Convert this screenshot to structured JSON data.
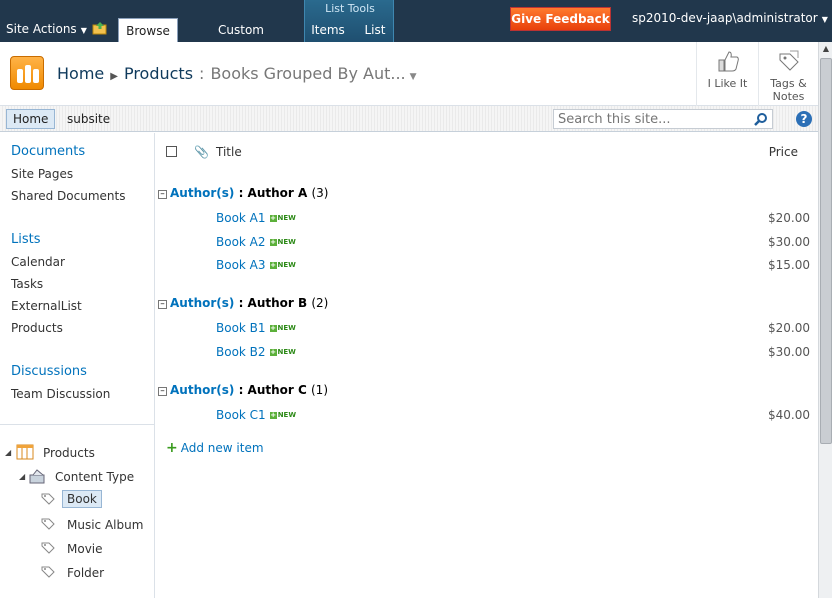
{
  "ribbon": {
    "site_actions": "Site Actions",
    "tabs": {
      "browse": "Browse",
      "custom": "Custom Commands",
      "items": "Items",
      "list": "List"
    },
    "contextual_group": "List Tools",
    "feedback": "Give Feedback",
    "user": "sp2010-dev-jaap\\administrator"
  },
  "title": {
    "home": "Home",
    "list": "Products",
    "view": "Books Grouped By Aut...",
    "like": "I Like It",
    "tags": "Tags &",
    "notes": "Notes"
  },
  "topnav": {
    "home": "Home",
    "subsite": "subsite",
    "search_placeholder": "Search this site...",
    "help": "?"
  },
  "leftnav": {
    "documents": "Documents",
    "site_pages": "Site Pages",
    "shared_documents": "Shared Documents",
    "lists": "Lists",
    "calendar": "Calendar",
    "tasks": "Tasks",
    "externallist": "ExternalList",
    "products": "Products",
    "discussions": "Discussions",
    "team_discussion": "Team Discussion",
    "tree": {
      "products": "Products",
      "content_type": "Content Type",
      "book": "Book",
      "music_album": "Music Album",
      "movie": "Movie",
      "folder": "Folder"
    }
  },
  "list": {
    "headers": {
      "title": "Title",
      "price": "Price"
    },
    "group_field": "Author(s)",
    "groups": [
      {
        "name": "Author A",
        "count": "(3)",
        "items": [
          {
            "title": "Book A1",
            "price": "$20.00"
          },
          {
            "title": "Book A2",
            "price": "$30.00"
          },
          {
            "title": "Book A3",
            "price": "$15.00"
          }
        ]
      },
      {
        "name": "Author B",
        "count": "(2)",
        "items": [
          {
            "title": "Book B1",
            "price": "$20.00"
          },
          {
            "title": "Book B2",
            "price": "$30.00"
          }
        ]
      },
      {
        "name": "Author C",
        "count": "(1)",
        "items": [
          {
            "title": "Book C1",
            "price": "$40.00"
          }
        ]
      }
    ],
    "new_label": "NEW",
    "add_new": "Add new item"
  }
}
